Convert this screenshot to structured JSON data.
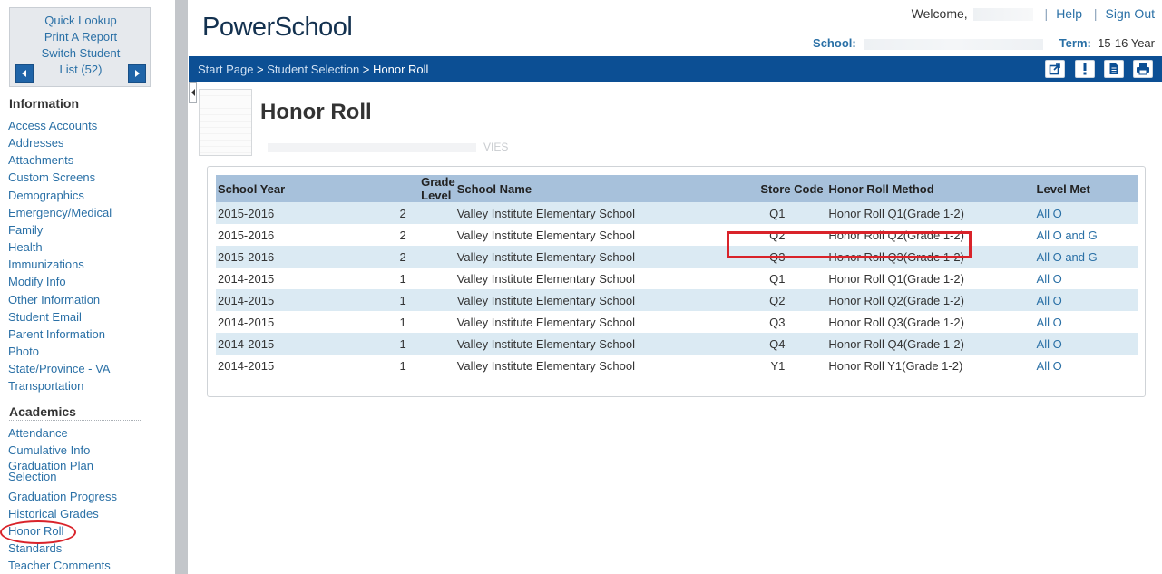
{
  "quick_links": {
    "quick_lookup": "Quick Lookup",
    "print_report": "Print A Report",
    "switch_student": "Switch Student",
    "list_count": "List (52)"
  },
  "nav": {
    "information_heading": "Information",
    "information_items": [
      "Access Accounts",
      "Addresses",
      "Attachments",
      "Custom Screens",
      "Demographics",
      "Emergency/Medical",
      "Family",
      "Health",
      "Immunizations",
      "Modify Info",
      "Other Information",
      "Student Email",
      "Parent Information",
      "Photo",
      "State/Province - VA",
      "Transportation"
    ],
    "academics_heading": "Academics",
    "academics_items": [
      "Attendance",
      "Cumulative Info",
      "Graduation Plan Selection",
      "Graduation Progress",
      "Historical Grades",
      "Honor Roll",
      "Standards",
      "Teacher Comments"
    ]
  },
  "header": {
    "logo": "PowerSchool",
    "welcome": "Welcome,",
    "help": "Help",
    "sign_out": "Sign Out",
    "school_label": "School:",
    "term_label": "Term:",
    "term_value": "15-16 Year"
  },
  "breadcrumb": {
    "start_page": "Start Page",
    "student_selection": "Student Selection",
    "current": "Honor Roll",
    "sep": " > "
  },
  "page": {
    "title": "Honor Roll",
    "student_info_suffix": "VIES"
  },
  "table": {
    "headers": [
      "School Year",
      "Grade Level",
      "School Name",
      "Store Code",
      "Honor Roll Method",
      "Level Met"
    ],
    "rows": [
      [
        "2015-2016",
        "2",
        "Valley Institute Elementary School",
        "Q1",
        "Honor Roll Q1(Grade 1-2)",
        "All O"
      ],
      [
        "2015-2016",
        "2",
        "Valley Institute Elementary School",
        "Q2",
        "Honor Roll Q2(Grade 1-2)",
        "All O and G"
      ],
      [
        "2015-2016",
        "2",
        "Valley Institute Elementary School",
        "Q3",
        "Honor Roll Q3(Grade 1-2)",
        "All O and G"
      ],
      [
        "2014-2015",
        "1",
        "Valley Institute Elementary School",
        "Q1",
        "Honor Roll Q1(Grade 1-2)",
        "All O"
      ],
      [
        "2014-2015",
        "1",
        "Valley Institute Elementary School",
        "Q2",
        "Honor Roll Q2(Grade 1-2)",
        "All O"
      ],
      [
        "2014-2015",
        "1",
        "Valley Institute Elementary School",
        "Q3",
        "Honor Roll Q3(Grade 1-2)",
        "All O"
      ],
      [
        "2014-2015",
        "1",
        "Valley Institute Elementary School",
        "Q4",
        "Honor Roll Q4(Grade 1-2)",
        "All O"
      ],
      [
        "2014-2015",
        "1",
        "Valley Institute Elementary School",
        "Y1",
        "Honor Roll Y1(Grade 1-2)",
        "All O"
      ]
    ]
  },
  "colors": {
    "brand_navy": "#0c4f94",
    "link_blue": "#2a70a6",
    "row_stripe": "#dbeaf3",
    "header_blue": "#a7c1db",
    "highlight_red": "#d9232a"
  }
}
